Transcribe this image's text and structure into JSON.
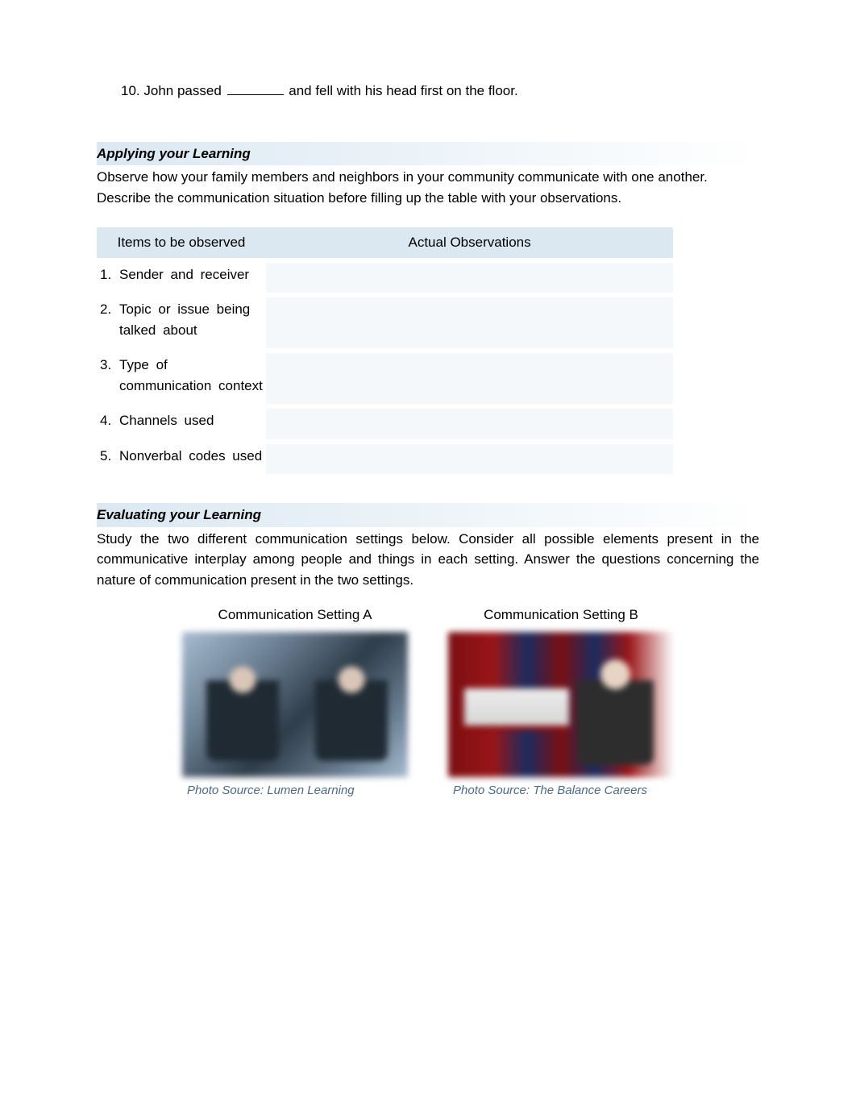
{
  "question": {
    "number": "10.",
    "before": "John passed",
    "after": "and fell with his head first on the floor."
  },
  "applying": {
    "heading": "Applying your Learning",
    "intro": " Observe how your family members and neighbors in your community communicate with one another. Describe the communication situation before filling up the table with your observations.",
    "table": {
      "header_left": "Items to be observed",
      "header_right": "Actual Observations",
      "rows": [
        {
          "num": "1.",
          "text": "Sender and receiver"
        },
        {
          "num": "2.",
          "text": "Topic or issue being talked about"
        },
        {
          "num": "3.",
          "text": "Type of communication context"
        },
        {
          "num": "4.",
          "text": "Channels used"
        },
        {
          "num": "5.",
          "text": "Nonverbal codes used"
        }
      ]
    }
  },
  "evaluating": {
    "heading": "Evaluating your Learning",
    "intro": "Study the two different communication settings below. Consider all possible elements present in the communicative interplay among people and things in each setting. Answer the questions concerning the nature of communication present in the two settings.",
    "setting_a": {
      "label": "Communication Setting A",
      "caption": "Photo Source: Lumen Learning"
    },
    "setting_b": {
      "label": "Communication Setting B",
      "caption": "Photo Source: The Balance Careers"
    }
  }
}
